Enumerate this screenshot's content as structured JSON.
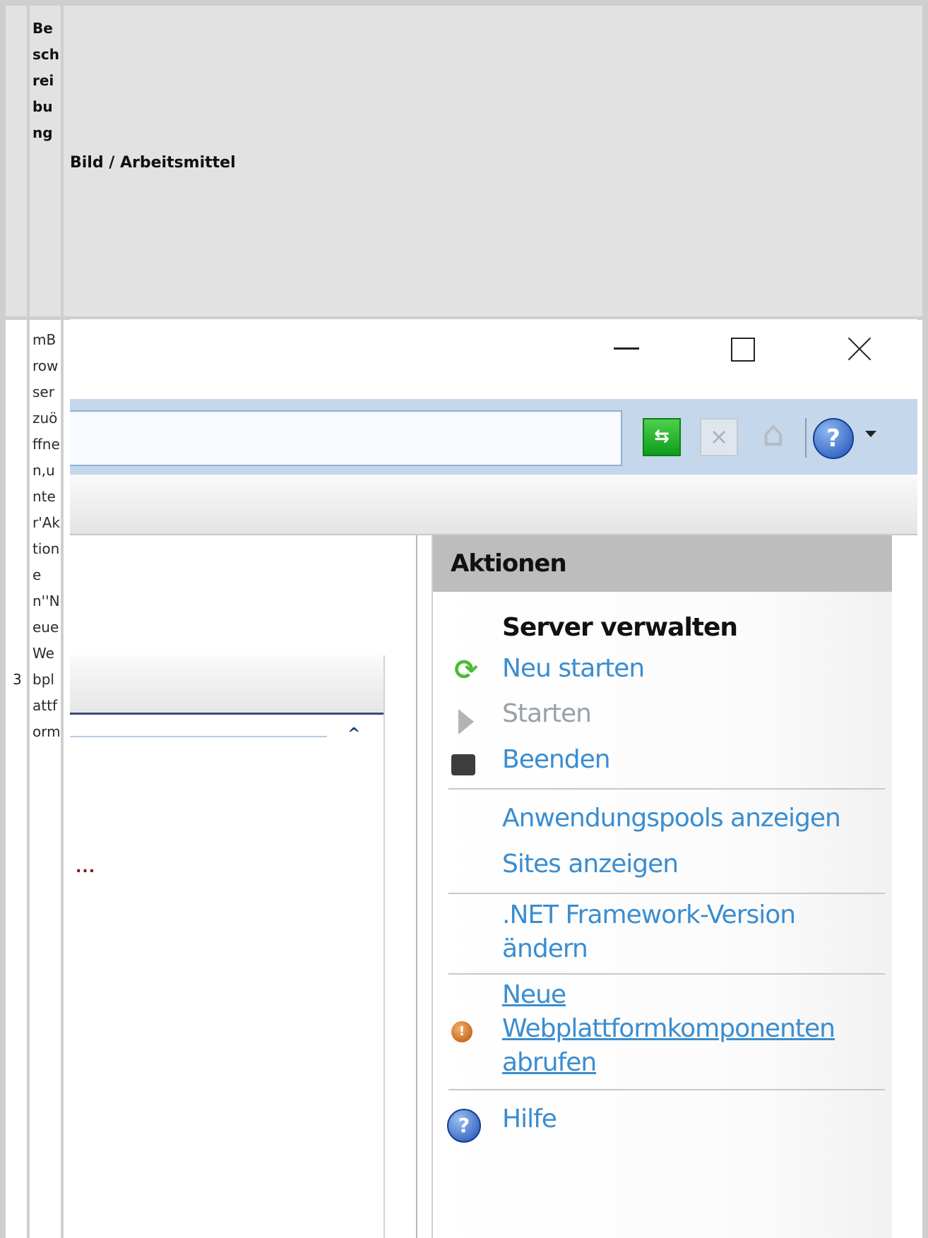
{
  "table": {
    "header_col1_vertical": "Beschreibung",
    "header_col2": "Bild / Arbeitsmittel",
    "row_number": "3",
    "row_desc_vertical": "mBrowserzuöffnen,unter'Aktionen''NeueWebplattform"
  },
  "screenshot": {
    "window_controls": [
      "minimize",
      "maximize",
      "close"
    ],
    "toolbar_icons": [
      "refresh-icon",
      "stop-icon",
      "home-icon",
      "help-icon",
      "dropdown-icon"
    ],
    "actions": {
      "title": "Aktionen",
      "section_label": "Server verwalten",
      "links": [
        {
          "label": "Neu starten",
          "state": "enabled"
        },
        {
          "label": "Starten",
          "state": "disabled"
        },
        {
          "label": "Beenden",
          "state": "enabled"
        },
        {
          "label": "Anwendungspools anzeigen",
          "state": "enabled"
        },
        {
          "label": "Sites anzeigen",
          "state": "enabled"
        },
        {
          "label_line1": ".NET Framework-Version",
          "label_line2": "ändern",
          "state": "enabled"
        },
        {
          "label_line1": "Neue ",
          "label_line2": "Webplattformkomponenten ",
          "label_line3": "abrufen",
          "state": "enabled"
        },
        {
          "label": "Hilfe",
          "state": "enabled"
        }
      ]
    },
    "left_pane": {
      "ellipsis": "..."
    }
  },
  "colors": {
    "link": "#3a8dd0",
    "disabled": "#9aa0a6",
    "header_bg": "#e2e2e2",
    "toolbar_bg": "#c5d7ea"
  }
}
